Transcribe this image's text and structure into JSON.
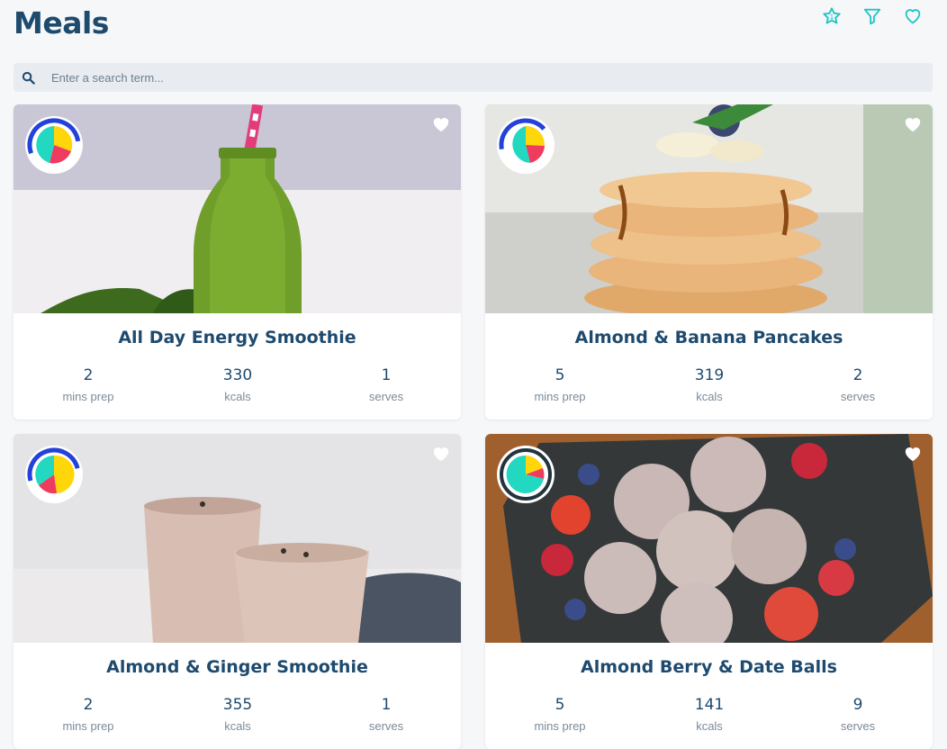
{
  "header": {
    "title": "Meals",
    "icons": [
      "star-icon",
      "filter-icon",
      "heart-icon"
    ]
  },
  "search": {
    "placeholder": "Enter a search term..."
  },
  "colors": {
    "title": "#1e4a6e",
    "accent": "#20c4c4",
    "macro_blue": "#2442d9",
    "macro_yellow": "#ffd60a",
    "macro_teal": "#22d8c0",
    "macro_pink": "#ef3b5e"
  },
  "meals": [
    {
      "name": "All Day Energy Smoothie",
      "prep": "2",
      "prep_label": "mins prep",
      "kcals": "330",
      "kcals_label": "kcals",
      "serves": "1",
      "serves_label": "serves"
    },
    {
      "name": "Almond & Banana Pancakes",
      "prep": "5",
      "prep_label": "mins prep",
      "kcals": "319",
      "kcals_label": "kcals",
      "serves": "2",
      "serves_label": "serves"
    },
    {
      "name": "Almond & Ginger Smoothie",
      "prep": "2",
      "prep_label": "mins prep",
      "kcals": "355",
      "kcals_label": "kcals",
      "serves": "1",
      "serves_label": "serves"
    },
    {
      "name": "Almond Berry & Date Balls",
      "prep": "5",
      "prep_label": "mins prep",
      "kcals": "141",
      "kcals_label": "kcals",
      "serves": "9",
      "serves_label": "serves"
    }
  ]
}
